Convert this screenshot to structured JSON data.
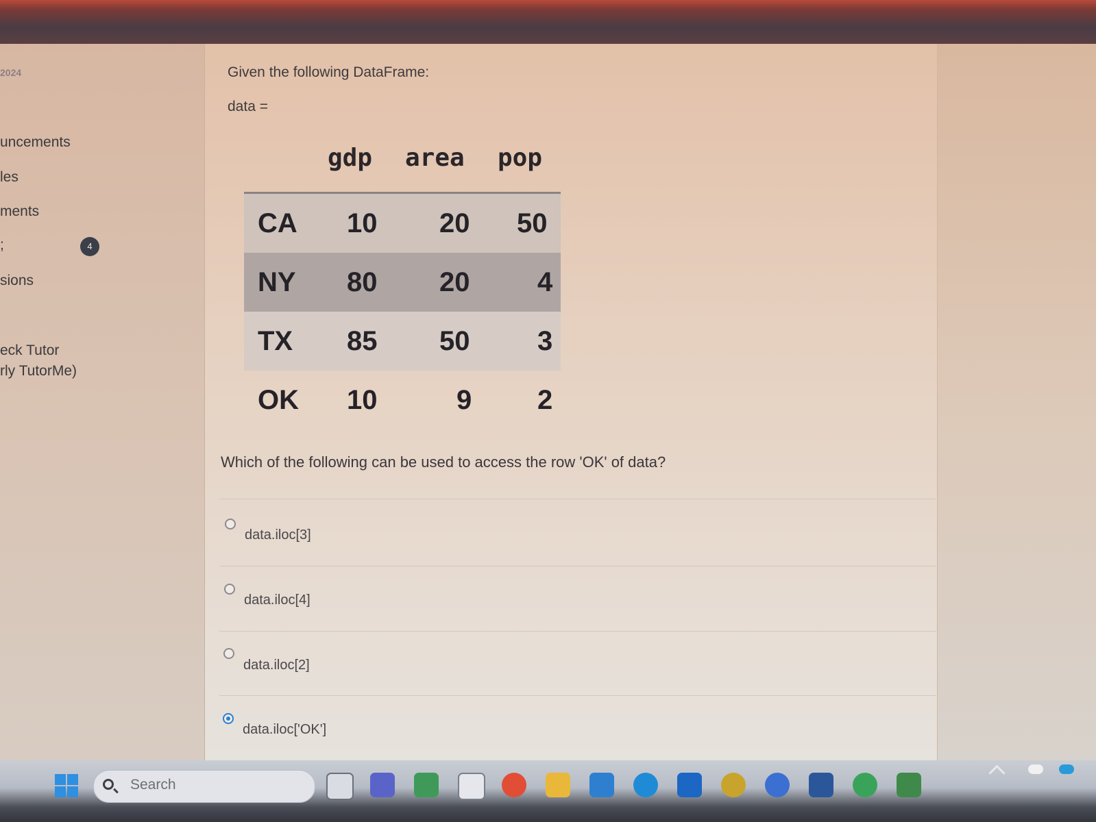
{
  "sidebar": {
    "items": [
      {
        "label": "2024"
      },
      {
        "label": "uncements"
      },
      {
        "label": "les"
      },
      {
        "label": "ments"
      },
      {
        "label": ";",
        "badge": "4"
      },
      {
        "label": "sions"
      },
      {
        "label": "eck Tutor"
      },
      {
        "label": "rly TutorMe)"
      }
    ]
  },
  "question": {
    "intro": "Given the following DataFrame:",
    "assign": "data =",
    "dataframe": {
      "columns": [
        "gdp",
        "area",
        "pop"
      ],
      "rows": [
        {
          "index": "CA",
          "gdp": "10",
          "area": "20",
          "pop": "50"
        },
        {
          "index": "NY",
          "gdp": "80",
          "area": "20",
          "pop": "4"
        },
        {
          "index": "TX",
          "gdp": "85",
          "area": "50",
          "pop": "3"
        },
        {
          "index": "OK",
          "gdp": "10",
          "area": "9",
          "pop": "2"
        }
      ]
    },
    "prompt": "Which of the following can be used to access the row 'OK' of data?",
    "options": [
      {
        "label": "data.iloc[3]",
        "selected": false
      },
      {
        "label": "data.iloc[4]",
        "selected": false
      },
      {
        "label": "data.iloc[2]",
        "selected": false
      },
      {
        "label": "data.iloc['OK']",
        "selected": true
      }
    ]
  },
  "taskbar": {
    "search_placeholder": "Search",
    "icons": [
      "file-explorer-icon",
      "teams-icon",
      "meet-icon",
      "calendar-icon",
      "chrome-icon",
      "folder-icon",
      "mail-icon",
      "edge-icon",
      "dropbox-icon",
      "app-icon",
      "cc-icon",
      "word-icon",
      "chrome-profile-icon",
      "spreadsheet-icon"
    ],
    "colors": {
      "accent": "#2f8fe0"
    }
  }
}
